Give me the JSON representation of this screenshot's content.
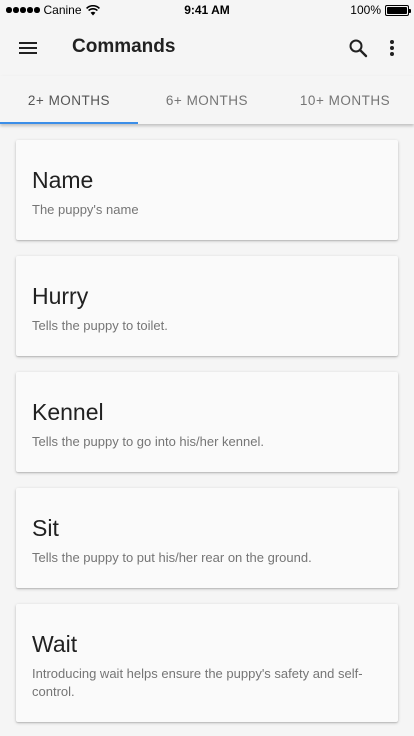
{
  "status_bar": {
    "carrier": "Canine",
    "time": "9:41 AM",
    "battery": "100%",
    "battery_level": 1.0
  },
  "app_bar": {
    "title": "Commands",
    "icons": [
      "menu-icon",
      "search-icon",
      "more-vert-icon"
    ]
  },
  "tabs": [
    {
      "label": "2+ MONTHS",
      "active": true
    },
    {
      "label": "6+ MONTHS",
      "active": false
    },
    {
      "label": "10+ MONTHS",
      "active": false
    }
  ],
  "accent_color": "#3b8ee8",
  "commands": [
    {
      "title": "Name",
      "description": "The puppy's name"
    },
    {
      "title": "Hurry",
      "description": "Tells the puppy to toilet."
    },
    {
      "title": "Kennel",
      "description": "Tells the puppy to go into his/her kennel."
    },
    {
      "title": "Sit",
      "description": "Tells the puppy to put his/her rear on the ground."
    },
    {
      "title": "Wait",
      "description": "Introducing wait helps ensure the puppy's safety and self-control."
    }
  ]
}
